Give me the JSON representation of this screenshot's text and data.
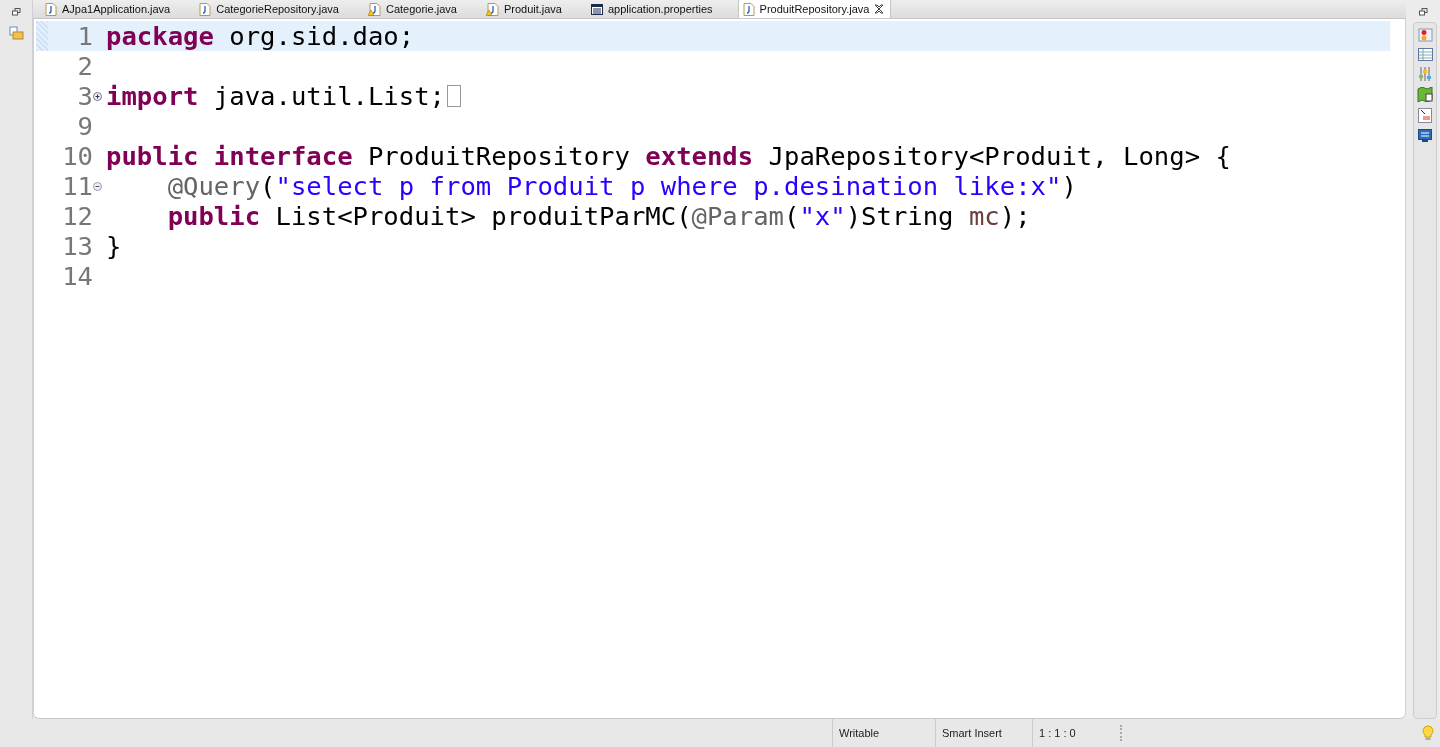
{
  "tabs": [
    {
      "label": "AJpa1Application.java",
      "kind": "java",
      "selected": false
    },
    {
      "label": "CategorieRepository.java",
      "kind": "java",
      "selected": false
    },
    {
      "label": "Categorie.java",
      "kind": "java-warning",
      "selected": false
    },
    {
      "label": "Produit.java",
      "kind": "java-warning",
      "selected": false
    },
    {
      "label": "application.properties",
      "kind": "properties",
      "selected": false
    },
    {
      "label": "ProduitRepository.java",
      "kind": "java",
      "selected": true
    }
  ],
  "editor": {
    "lines": [
      {
        "number": "1",
        "current": true,
        "tokens": [
          {
            "text": "package",
            "kind": "keyword"
          },
          {
            "text": " org.sid.dao;",
            "kind": "plain"
          }
        ]
      },
      {
        "number": "2",
        "current": false
      },
      {
        "number": "3",
        "current": false,
        "foldable": true,
        "folded": true,
        "tokens": [
          {
            "text": "import",
            "kind": "keyword"
          },
          {
            "text": " java.util.List;",
            "kind": "plain"
          }
        ]
      },
      {
        "number": "9",
        "current": false
      },
      {
        "number": "10",
        "current": false,
        "tokens": [
          {
            "text": "public interface",
            "kind": "keyword"
          },
          {
            "text": " ProduitRepository ",
            "kind": "plain"
          },
          {
            "text": "extends",
            "kind": "keyword"
          },
          {
            "text": " JpaRepository<Produit, Long> {",
            "kind": "plain"
          }
        ]
      },
      {
        "number": "11",
        "current": false,
        "foldable": true,
        "folded": false,
        "tokens": [
          {
            "text": "    @Query",
            "kind": "annotation"
          },
          {
            "text": "(",
            "kind": "plain"
          },
          {
            "text": "\"select p from Produit p where p.desination like:x\"",
            "kind": "string"
          },
          {
            "text": ")",
            "kind": "plain"
          }
        ]
      },
      {
        "number": "12",
        "current": false,
        "tokens": [
          {
            "text": "    public",
            "kind": "keyword"
          },
          {
            "text": " List<Produit> produitParMC(",
            "kind": "plain"
          },
          {
            "text": "@Param",
            "kind": "annotation"
          },
          {
            "text": "(",
            "kind": "plain"
          },
          {
            "text": "\"x\"",
            "kind": "string"
          },
          {
            "text": ")String ",
            "kind": "plain"
          },
          {
            "text": "mc",
            "kind": "variable"
          },
          {
            "text": ");",
            "kind": "plain"
          }
        ]
      },
      {
        "number": "13",
        "current": false,
        "tokens": [
          {
            "text": "}",
            "kind": "plain"
          }
        ]
      },
      {
        "number": "14",
        "current": false
      }
    ]
  },
  "status_bar": [
    "Writable",
    "Smart Insert",
    "1 : 1 : 0"
  ]
}
